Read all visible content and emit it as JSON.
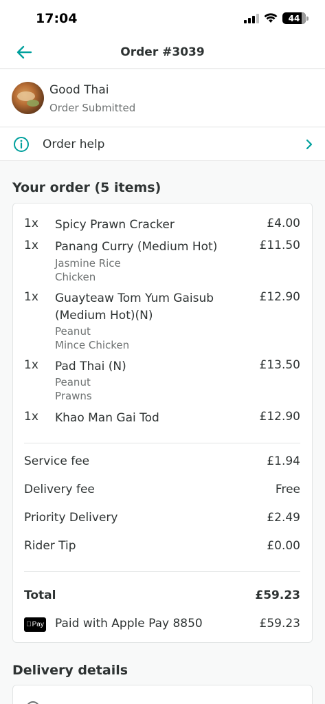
{
  "status_bar": {
    "time": "17:04",
    "battery": "44"
  },
  "nav": {
    "title": "Order #3039"
  },
  "restaurant": {
    "name": "Good Thai",
    "status": "Order Submitted"
  },
  "help": {
    "label": "Order help"
  },
  "order": {
    "heading": "Your order (5 items)",
    "items": [
      {
        "qty": "1x",
        "name": "Spicy Prawn Cracker",
        "price": "£4.00",
        "modifiers": []
      },
      {
        "qty": "1x",
        "name": "Panang Curry (Medium Hot)",
        "price": "£11.50",
        "modifiers": [
          "Jasmine Rice",
          "Chicken"
        ]
      },
      {
        "qty": "1x",
        "name": "Guayteaw Tom Yum Gaisub (Medium Hot)(N)",
        "price": "£12.90",
        "modifiers": [
          "Peanut",
          "Mince Chicken"
        ]
      },
      {
        "qty": "1x",
        "name": "Pad Thai (N)",
        "price": "£13.50",
        "modifiers": [
          "Peanut",
          "Prawns"
        ]
      },
      {
        "qty": "1x",
        "name": "Khao Man Gai Tod",
        "price": "£12.90",
        "modifiers": []
      }
    ],
    "fees": [
      {
        "label": "Service fee",
        "value": "£1.94"
      },
      {
        "label": "Delivery fee",
        "value": "Free"
      },
      {
        "label": "Priority Delivery",
        "value": "£2.49"
      },
      {
        "label": "Rider Tip",
        "value": "£0.00"
      }
    ],
    "total": {
      "label": "Total",
      "value": "£59.23"
    },
    "payment": {
      "icon_text": "Pay",
      "label": "Paid with Apple Pay 8850",
      "value": "£59.23"
    }
  },
  "delivery": {
    "heading": "Delivery details"
  },
  "colors": {
    "accent": "#00a09d",
    "text": "#2e3333",
    "muted": "#6e7272"
  }
}
